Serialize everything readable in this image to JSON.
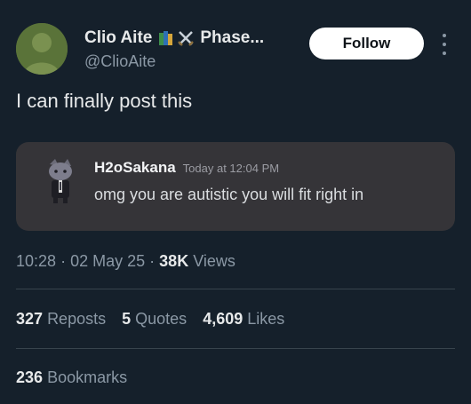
{
  "author": {
    "display_name": "Clio Aite",
    "display_name_suffix": "Phase...",
    "handle": "@ClioAite",
    "emoji_icons": [
      "books-icon",
      "crossed-swords-icon"
    ]
  },
  "follow_button": {
    "label": "Follow"
  },
  "tweet": {
    "text": "I can finally post this"
  },
  "embed": {
    "username": "H2oSakana",
    "timestamp": "Today at 12:04 PM",
    "message": "omg you are autistic you will fit right in"
  },
  "meta": {
    "time": "10:28",
    "sep1": "·",
    "date": "02 May 25",
    "sep2": "·",
    "views_count": "38K",
    "views_label": "Views"
  },
  "stats": {
    "reposts_count": "327",
    "reposts_label": "Reposts",
    "quotes_count": "5",
    "quotes_label": "Quotes",
    "likes_count": "4,609",
    "likes_label": "Likes",
    "bookmarks_count": "236",
    "bookmarks_label": "Bookmarks"
  },
  "colors": {
    "background": "#15202b",
    "text": "#e7e9ea",
    "muted": "#8b98a5",
    "embed_bg": "#353438",
    "avatar_green": "#59733a"
  }
}
